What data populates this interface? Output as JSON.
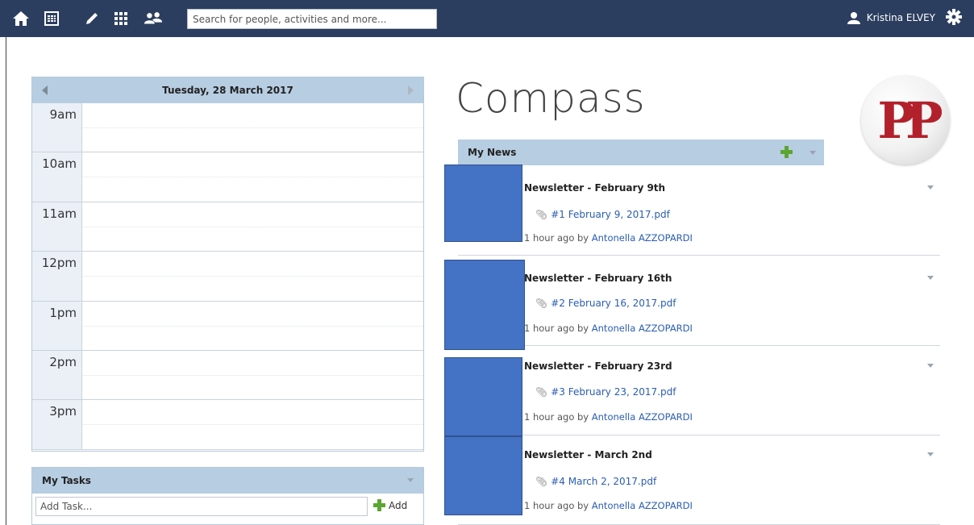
{
  "topbar": {
    "icons": [
      "home-icon",
      "calendar-icon",
      "pencil-icon",
      "grid-icon",
      "people-icon"
    ],
    "search_placeholder": "Search for people, activities and more...",
    "user_name": "Kristina ELVEY",
    "colors": {
      "bar": "#2c3e5f",
      "text": "#ffffff"
    }
  },
  "calendar": {
    "date_label": "Tuesday, 28 March 2017",
    "hours": [
      "9am",
      "10am",
      "11am",
      "12pm",
      "1pm",
      "2pm",
      "3pm"
    ]
  },
  "tasks": {
    "title": "My Tasks",
    "input_placeholder": "Add Task...",
    "add_label": "Add"
  },
  "main": {
    "title": "Compass",
    "logo_text": "PP"
  },
  "news": {
    "title": "My News",
    "items": [
      {
        "title": "Newsletter - February 9th",
        "file": "#1 February 9, 2017.pdf",
        "meta": "1 hour ago by",
        "author": "Antonella AZZOPARDI"
      },
      {
        "title": "Newsletter - February 16th",
        "file": "#2 February 16, 2017.pdf",
        "meta": "1 hour ago by",
        "author": "Antonella AZZOPARDI"
      },
      {
        "title": "Newsletter - February 23rd",
        "file": "#3 February 23, 2017.pdf",
        "meta": "1 hour ago by",
        "author": "Antonella AZZOPARDI"
      },
      {
        "title": "Newsletter - March 2nd",
        "file": "#4 March 2, 2017.pdf",
        "meta": "1 hour ago by",
        "author": "Antonella AZZOPARDI"
      }
    ]
  },
  "colors": {
    "accent": "#b7cde2",
    "link": "#2a5db0",
    "add_green": "#5aa631",
    "redaction": "#4472c4"
  }
}
